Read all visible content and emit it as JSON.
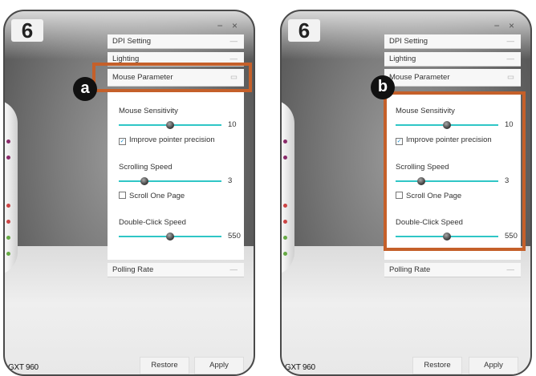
{
  "panels": {
    "a": {
      "step_label": "6",
      "badge": "a",
      "window_controls": "− ×",
      "menu": {
        "dpi": "DPI Setting",
        "lighting": "Lighting",
        "mouse_parameter": "Mouse Parameter",
        "polling": "Polling Rate"
      },
      "sensitivity": {
        "label": "Mouse Sensitivity",
        "value": "10",
        "level": 0.5
      },
      "precision": {
        "label": "Improve pointer precision",
        "checked": true
      },
      "scroll": {
        "label": "Scrolling Speed",
        "value": "3",
        "level": 0.25
      },
      "scroll_page": {
        "label": "Scroll One Page",
        "checked": false
      },
      "double_click": {
        "label": "Double-Click Speed",
        "value": "550",
        "level": 0.5
      },
      "restore": "Restore",
      "apply": "Apply",
      "model": "GXT 960"
    },
    "b": {
      "step_label": "6",
      "badge": "b",
      "window_controls": "− ×",
      "menu": {
        "dpi": "DPI Setting",
        "lighting": "Lighting",
        "mouse_parameter": "Mouse Parameter",
        "polling": "Polling Rate"
      },
      "sensitivity": {
        "label": "Mouse Sensitivity",
        "value": "10",
        "level": 0.5
      },
      "precision": {
        "label": "Improve pointer precision",
        "checked": true
      },
      "scroll": {
        "label": "Scrolling Speed",
        "value": "3",
        "level": 0.25
      },
      "scroll_page": {
        "label": "Scroll One Page",
        "checked": false
      },
      "double_click": {
        "label": "Double-Click Speed",
        "value": "550",
        "level": 0.5
      },
      "restore": "Restore",
      "apply": "Apply",
      "model": "GXT 960"
    }
  },
  "colors": {
    "highlight": "#c5602a",
    "slider_track": "#2fc6c6"
  }
}
